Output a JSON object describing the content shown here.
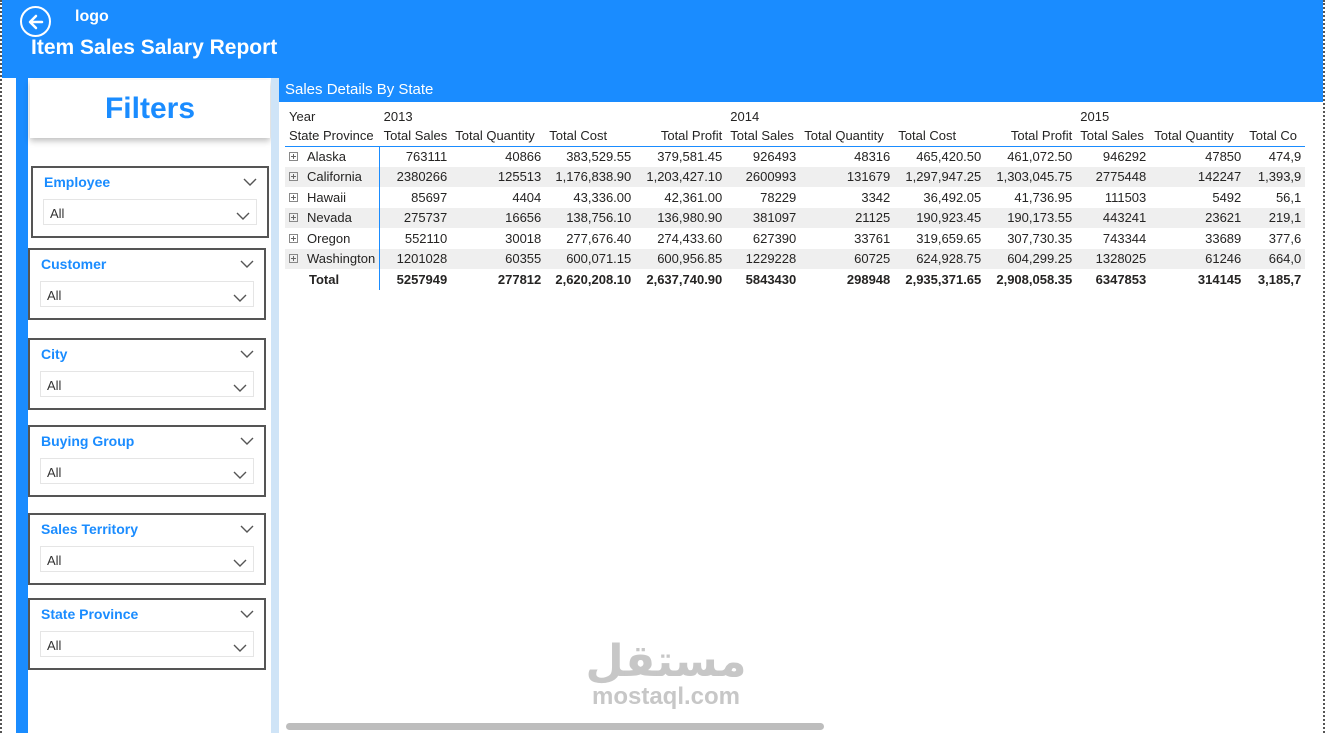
{
  "header": {
    "logo": "logo",
    "title": "Item Sales Salary Report",
    "back_icon": "arrow-left-circle-icon",
    "color": "#1a8cff"
  },
  "sidebar": {
    "title": "Filters",
    "slicers": [
      {
        "label": "Employee",
        "value": "All"
      },
      {
        "label": "Customer",
        "value": "All"
      },
      {
        "label": "City",
        "value": "All"
      },
      {
        "label": "Buying Group",
        "value": "All"
      },
      {
        "label": "Sales Territory",
        "value": "All"
      },
      {
        "label": "State Province",
        "value": "All"
      }
    ]
  },
  "visual": {
    "title": "Sales Details By State",
    "row_axis_label": "Year",
    "row_header_label": "State Province",
    "years": [
      "2013",
      "2014",
      "2015"
    ],
    "measures": [
      "Total Sales",
      "Total Quantity",
      "Total Cost",
      "Total Profit",
      "Total Sales",
      "Total Quantity",
      "Total Cost",
      "Total Profit",
      "Total Sales",
      "Total Quantity",
      "Total Co"
    ],
    "rows": [
      {
        "state": "Alaska",
        "cells": [
          "763111",
          "40866",
          "383,529.55",
          "379,581.45",
          "926493",
          "48316",
          "465,420.50",
          "461,072.50",
          "946292",
          "47850",
          "474,9"
        ]
      },
      {
        "state": "California",
        "cells": [
          "2380266",
          "125513",
          "1,176,838.90",
          "1,203,427.10",
          "2600993",
          "131679",
          "1,297,947.25",
          "1,303,045.75",
          "2775448",
          "142247",
          "1,393,9"
        ]
      },
      {
        "state": "Hawaii",
        "cells": [
          "85697",
          "4404",
          "43,336.00",
          "42,361.00",
          "78229",
          "3342",
          "36,492.05",
          "41,736.95",
          "111503",
          "5492",
          "56,1"
        ]
      },
      {
        "state": "Nevada",
        "cells": [
          "275737",
          "16656",
          "138,756.10",
          "136,980.90",
          "381097",
          "21125",
          "190,923.45",
          "190,173.55",
          "443241",
          "23621",
          "219,1"
        ]
      },
      {
        "state": "Oregon",
        "cells": [
          "552110",
          "30018",
          "277,676.40",
          "274,433.60",
          "627390",
          "33761",
          "319,659.65",
          "307,730.35",
          "743344",
          "33689",
          "377,6"
        ]
      },
      {
        "state": "Washington",
        "cells": [
          "1201028",
          "60355",
          "600,071.15",
          "600,956.85",
          "1229228",
          "60725",
          "624,928.75",
          "604,299.25",
          "1328025",
          "61246",
          "664,0"
        ]
      }
    ],
    "total": {
      "label": "Total",
      "cells": [
        "5257949",
        "277812",
        "2,620,208.10",
        "2,637,740.90",
        "5843430",
        "298948",
        "2,935,371.65",
        "2,908,058.35",
        "6347853",
        "314145",
        "3,185,7"
      ]
    }
  },
  "watermark": {
    "arabic": "مستقل",
    "latin": "mostaql.com"
  }
}
